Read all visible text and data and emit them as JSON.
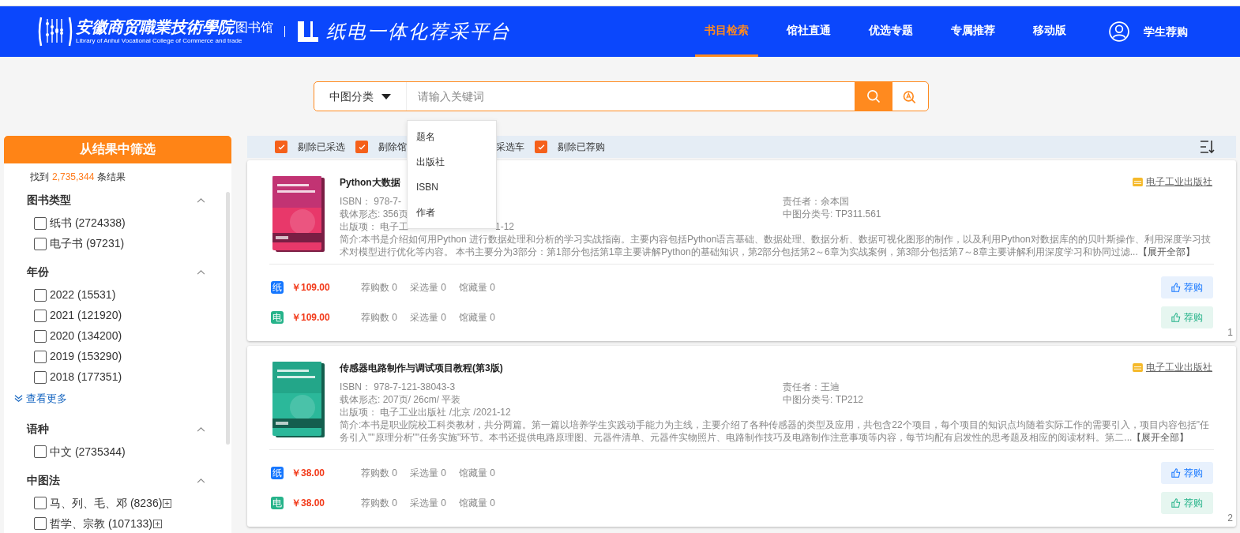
{
  "header": {
    "school_name": "安徽商贸職業技術學院",
    "library": "图书馆",
    "english_name": "Library of Anhul Vocational College of Commerce and trade",
    "platform": "纸电一体化荐采平台",
    "nav": [
      {
        "label": "书目检索",
        "selected": true
      },
      {
        "label": "馆社直通",
        "selected": false
      },
      {
        "label": "优选专题",
        "selected": false
      },
      {
        "label": "专属推荐",
        "selected": false
      },
      {
        "label": "移动版",
        "selected": false
      }
    ],
    "user": "学生荐购"
  },
  "search": {
    "category": "中图分类",
    "placeholder": "请输入关键词",
    "menu": [
      "题名",
      "出版社",
      "ISBN",
      "作者"
    ]
  },
  "sidebar": {
    "title": "从结果中筛选",
    "result_prefix": "找到",
    "result_count": "2,735,344",
    "result_suffix": "条结果",
    "sections": [
      {
        "title": "图书类型",
        "expanded": true,
        "options": [
          {
            "label": "纸书 (2724338)",
            "checked": false,
            "expandable": false
          },
          {
            "label": "电子书 (97231)",
            "checked": false,
            "expandable": false
          }
        ]
      },
      {
        "title": "年份",
        "expanded": true,
        "more": "查看更多",
        "options": [
          {
            "label": "2022 (15531)",
            "checked": false,
            "expandable": false
          },
          {
            "label": "2021 (121920)",
            "checked": false,
            "expandable": false
          },
          {
            "label": "2020 (134200)",
            "checked": false,
            "expandable": false
          },
          {
            "label": "2019 (153290)",
            "checked": false,
            "expandable": false
          },
          {
            "label": "2018 (177351)",
            "checked": false,
            "expandable": false
          }
        ]
      },
      {
        "title": "语种",
        "expanded": true,
        "options": [
          {
            "label": "中文 (2735344)",
            "checked": false,
            "expandable": false
          }
        ]
      },
      {
        "title": "中图法",
        "expanded": true,
        "options": [
          {
            "label": "马、列、毛、邓 (8236)",
            "checked": false,
            "expandable": true
          },
          {
            "label": "哲学、宗教 (107133)",
            "checked": false,
            "expandable": true
          }
        ]
      }
    ]
  },
  "filters": [
    {
      "label": "剔除已采选",
      "checked": true
    },
    {
      "label": "剔除馆",
      "checked": true
    },
    {
      "label": "采选车"
    },
    {
      "label": "剔除已荐购",
      "checked": true
    }
  ],
  "books": [
    {
      "title": "Python大数据",
      "publisher": "电子工业出版社",
      "left": [
        {
          "text": "ISBN： 978-7-"
        },
        {
          "text": "载体形态: 356页"
        },
        {
          "text": "出版项： 电子工",
          "tail": "1-12"
        }
      ],
      "right": [
        "责任者：余本国",
        "中图分类号: TP311.561"
      ],
      "summary": "简介:本书是介绍如何用Python 进行数据处理和分析的学习实战指南。主要内容包括Python语言基础、数据处理、数据分析、数据可视化图形的制作，以及利用Python对数据库的的贝叶斯操作、利用深度学习技术对模型进行优化等内容。 本书主要分为3部分：第1部分包括第1章主要讲解Python的基础知识，第2部分包括第2～6章为实战案例，第3部分包括第7～8章主要讲解利用深度学习和协同过滤...",
      "expand": "【展开全部】",
      "editions": [
        {
          "kind": "paper",
          "badge": "纸",
          "price": "￥109.00",
          "stats": [
            "荐购数 0",
            "采选量 0",
            "馆藏量 0"
          ],
          "action": "荐购"
        },
        {
          "kind": "ebook",
          "badge": "电",
          "price": "￥109.00",
          "stats": [
            "荐购数 0",
            "采选量 0",
            "馆藏量 0"
          ],
          "action": "荐购"
        }
      ],
      "index": "1"
    },
    {
      "title": "传感器电路制作与调试项目教程(第3版)",
      "publisher": "电子工业出版社",
      "left": [
        {
          "text": "ISBN： 978-7-121-38043-3"
        },
        {
          "text": "载体形态: 207页/ 26cm/ 平装"
        },
        {
          "text": "出版项： 电子工业出版社 /北京 /2021-12"
        }
      ],
      "right": [
        "责任者：王迪",
        "中图分类号: TP212"
      ],
      "summary": "简介:本书是职业院校工科类教材，共分两篇。第一篇以培养学生实践动手能力为主线，主要介绍了各种传感器的类型及应用，共包含22个项目，每个项目的知识点均随着实际工作的需要引入，项目内容包括\"任务引入\"\"原理分析\"\"任务实施\"环节。本书还提供电路原理图、元器件清单、元器件实物照片、电路制作技巧及电路制作注意事项等内容，每节均配有启发性的思考题及相应的阅读材料。第二...",
      "expand": "【展开全部】",
      "editions": [
        {
          "kind": "paper",
          "badge": "纸",
          "price": "￥38.00",
          "stats": [
            "荐购数 0",
            "采选量 0",
            "馆藏量 0"
          ],
          "action": "荐购"
        },
        {
          "kind": "ebook",
          "badge": "电",
          "price": "￥38.00",
          "stats": [
            "荐购数 0",
            "采选量 0",
            "馆藏量 0"
          ],
          "action": "荐购"
        }
      ],
      "index": "2"
    }
  ]
}
